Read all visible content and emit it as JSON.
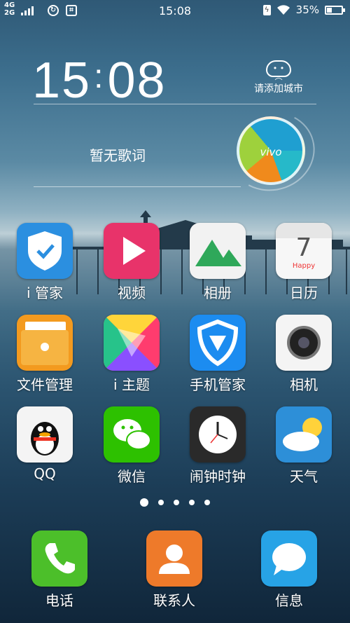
{
  "status_bar": {
    "network_top": "4G",
    "network_bottom": "2G",
    "time": "15:08",
    "battery_percent": "35%",
    "battery_level": 0.35,
    "icons": [
      "signal-icon",
      "vpn-icon",
      "screenshot-icon",
      "charging-icon",
      "wifi-icon",
      "battery-icon"
    ]
  },
  "widget": {
    "clock_hours": "15",
    "clock_minutes": "08",
    "weather_prompt": "请添加城市",
    "lyrics": "暂无歌词",
    "disc_brand": "vivo"
  },
  "apps": [
    {
      "label": "i 管家",
      "icon": "shield-check-icon",
      "color": "#2b8fe0"
    },
    {
      "label": "视频",
      "icon": "play-icon",
      "color": "#e8336a"
    },
    {
      "label": "相册",
      "icon": "mountain-icon",
      "color": "#f2f2f2"
    },
    {
      "label": "日历",
      "icon": "calendar-icon",
      "color": "#f7f7f7",
      "day": "7",
      "subtitle": "Happy"
    },
    {
      "label": "文件管理",
      "icon": "folder-icon",
      "color": "#f39a1f"
    },
    {
      "label": "i 主题",
      "icon": "theme-icon",
      "color": "#ff7a3c"
    },
    {
      "label": "手机管家",
      "icon": "tencent-shield-icon",
      "color": "#1c8cf0"
    },
    {
      "label": "相机",
      "icon": "camera-icon",
      "color": "#f4f4f4"
    },
    {
      "label": "QQ",
      "icon": "penguin-icon",
      "color": "#f4f4f4"
    },
    {
      "label": "微信",
      "icon": "wechat-icon",
      "color": "#2dc100"
    },
    {
      "label": "闹钟时钟",
      "icon": "clock-icon",
      "color": "#2a2a2a"
    },
    {
      "label": "天气",
      "icon": "weather-icon",
      "color": "#2d8fd8"
    }
  ],
  "page_indicator": {
    "pages": 5,
    "current": 1
  },
  "dock": [
    {
      "label": "电话",
      "icon": "phone-icon",
      "color": "#4cbf2a"
    },
    {
      "label": "联系人",
      "icon": "contact-icon",
      "color": "#ee7a2a"
    },
    {
      "label": "信息",
      "icon": "message-icon",
      "color": "#27a3e6"
    }
  ]
}
